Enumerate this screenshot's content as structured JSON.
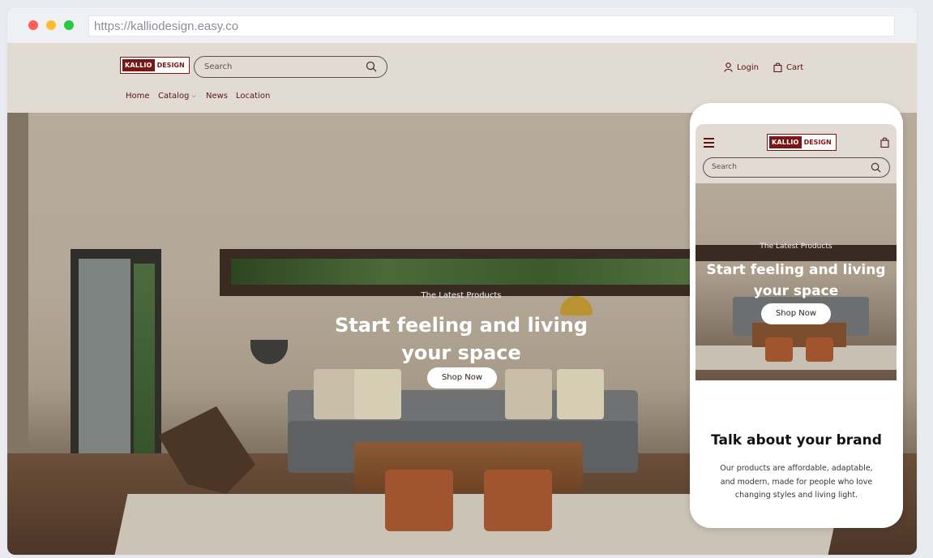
{
  "browser": {
    "url": "https://kalliodesign.easy.co"
  },
  "colors": {
    "accent": "#7a1616",
    "header_bg": "#e1dbd3",
    "text_dark": "#5b1414"
  },
  "site": {
    "logo": {
      "part1": "KALLIO",
      "part2": "DESIGN"
    },
    "search_placeholder": "Search",
    "nav": [
      {
        "label": "Home"
      },
      {
        "label": "Catalog",
        "has_dropdown": true
      },
      {
        "label": "News"
      },
      {
        "label": "Location"
      }
    ],
    "login_label": "Login",
    "cart_label": "Cart"
  },
  "hero": {
    "eyebrow": "The Latest Products",
    "title": "Start feeling and living your space",
    "button": "Shop Now"
  },
  "mobile": {
    "search_placeholder": "Search",
    "hero_eyebrow": "The Latest Products",
    "hero_title": "Start feeling and living your space",
    "hero_button": "Shop Now",
    "brand_title": "Talk about your brand",
    "brand_text": "Our products are affordable, adaptable, and modern, made for people who love changing styles and living light."
  },
  "icons": {
    "search": "search-icon",
    "user": "user-icon",
    "bag": "bag-icon",
    "menu": "menu-icon",
    "chevron": "chevron-down-icon"
  }
}
